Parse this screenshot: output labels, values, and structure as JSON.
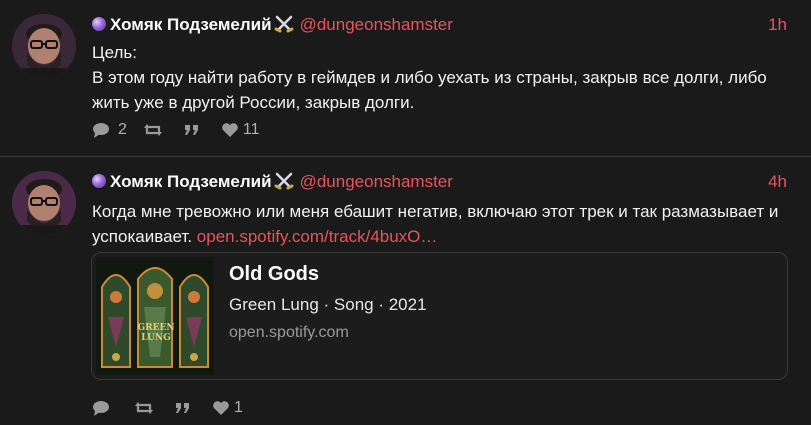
{
  "posts": [
    {
      "author_name": "Хомяк Подземелий",
      "handle": "@dungeonshamster",
      "time": "1h",
      "text": "Цель:\nВ этом году найти работу в геймдев и либо уехать из страны, закрыв все долги, либо жить уже в другой России, закрыв долги.",
      "replies": "2",
      "boosts": "",
      "quotes": "",
      "likes": "11"
    },
    {
      "author_name": "Хомяк Подземелий",
      "handle": "@dungeonshamster",
      "time": "4h",
      "text": "Когда мне тревожно или меня ебашит негатив, включаю этот трек и так размазывает и успокаивает.",
      "link_text": "open.spotify.com/track/4buxO…",
      "card": {
        "title": "Old Gods",
        "subtitle": "Green Lung · Song · 2021",
        "domain": "open.spotify.com",
        "cover_text": "GREEN LUNG"
      },
      "replies": "",
      "boosts": "",
      "quotes": "",
      "likes": "1"
    }
  ],
  "colors": {
    "background": "#1a1a1a",
    "accent": "#e8545d",
    "text": "#f2f2f2",
    "muted": "#9a9a9a"
  },
  "icons": [
    "comments-icon",
    "boost-icon",
    "quote-icon",
    "heart-icon",
    "crystal-ball-icon",
    "crossed-swords-icon"
  ]
}
